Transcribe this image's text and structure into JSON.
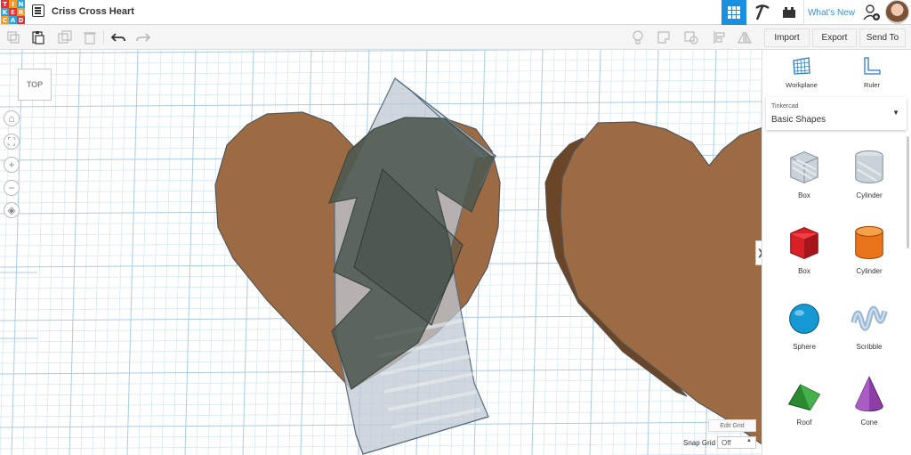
{
  "app": {
    "logo_letters": [
      "T",
      "I",
      "N",
      "K",
      "E",
      "R",
      "C",
      "A",
      "D"
    ],
    "logo_colors": [
      "#e0333a",
      "#f79a25",
      "#29a8e0",
      "#29a8e0",
      "#e0333a",
      "#f79a25",
      "#f79a25",
      "#29a8e0",
      "#e0333a"
    ]
  },
  "header": {
    "title": "Criss Cross Heart",
    "whats_new": "What's New"
  },
  "toolbar": {
    "import": "Import",
    "export": "Export",
    "send_to": "Send To"
  },
  "workplane": {
    "viewcube": "TOP",
    "edit_grid": "Edit Grid",
    "snap_grid_label": "Snap Grid",
    "snap_grid_value": "Off"
  },
  "panel": {
    "workplane_label": "Workplane",
    "ruler_label": "Ruler",
    "library_category": "Tinkercad",
    "library_value": "Basic Shapes",
    "shapes": [
      {
        "label": "Box",
        "icon": "box-hole-icon"
      },
      {
        "label": "Cylinder",
        "icon": "cylinder-hole-icon"
      },
      {
        "label": "Box",
        "icon": "box-red-icon"
      },
      {
        "label": "Cylinder",
        "icon": "cylinder-orange-icon"
      },
      {
        "label": "Sphere",
        "icon": "sphere-icon"
      },
      {
        "label": "Scribble",
        "icon": "scribble-icon"
      },
      {
        "label": "Roof",
        "icon": "roof-icon"
      },
      {
        "label": "Cone",
        "icon": "cone-icon"
      }
    ]
  },
  "colors": {
    "accent": "#1a8fe0",
    "heart": "#9c6b44",
    "heart_side": "#6b4528",
    "hole_fill": "#c8d2dc",
    "grid_line": "#c5dff0",
    "overlap": "#4b5850"
  }
}
